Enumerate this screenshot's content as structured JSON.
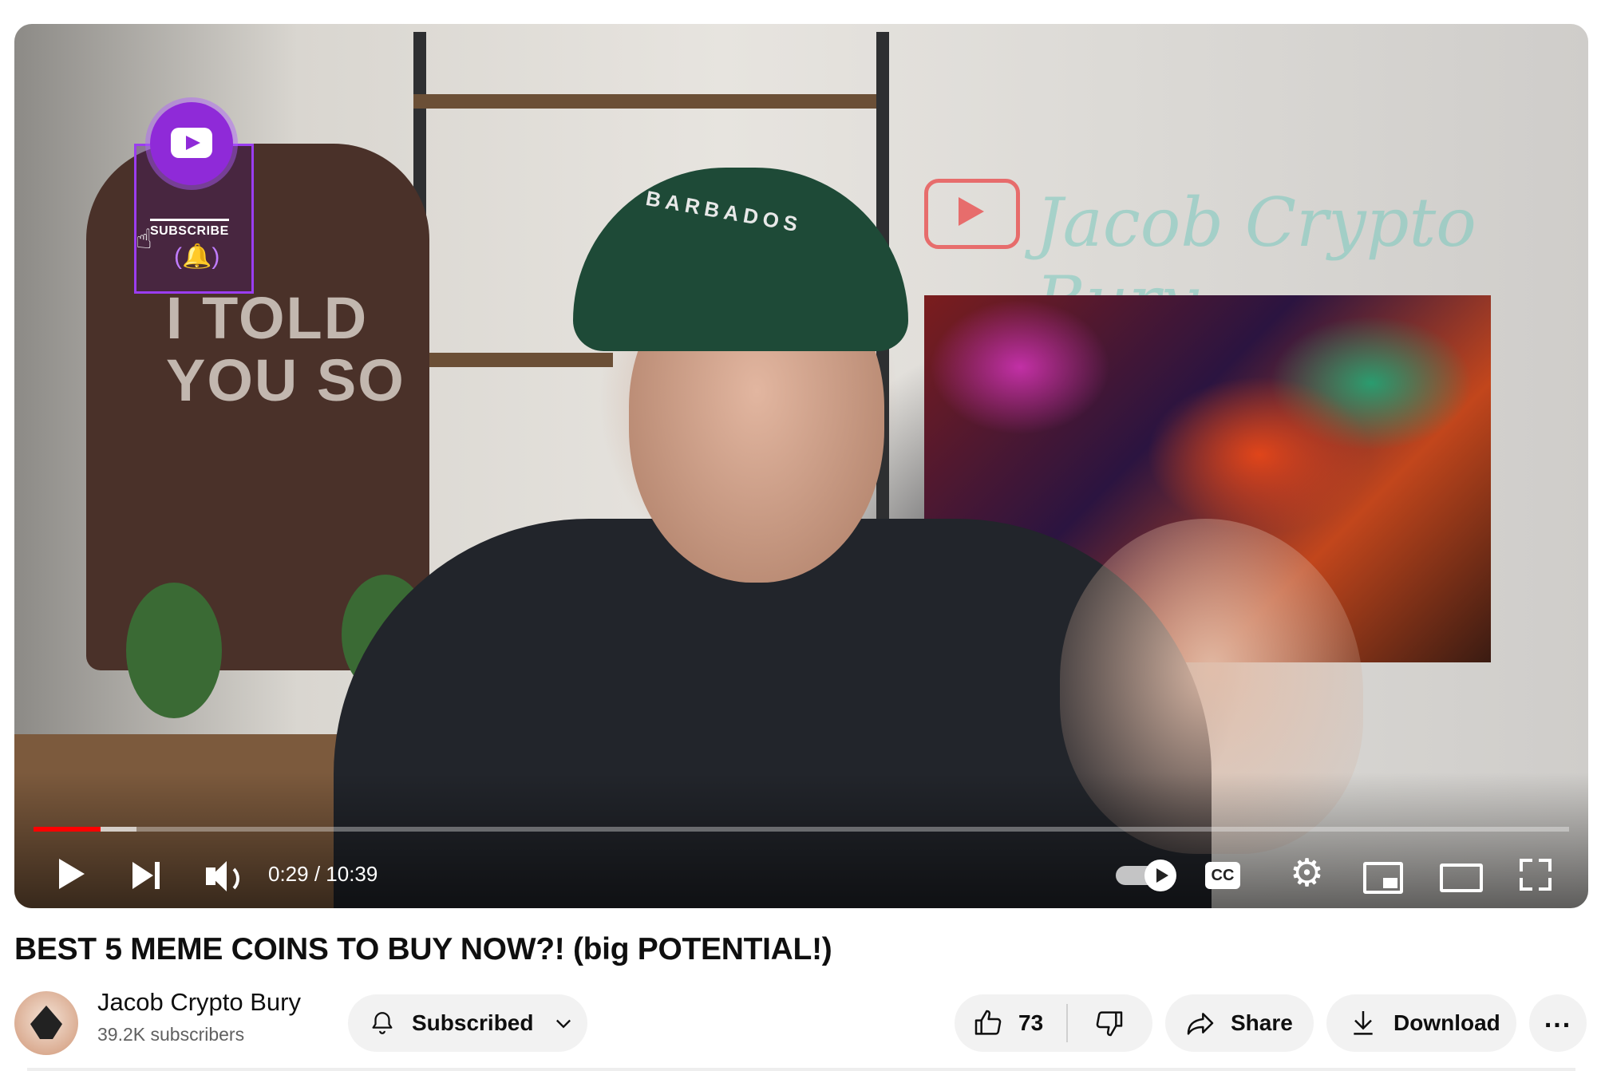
{
  "player": {
    "overlay": {
      "subscribe_label": "SUBSCRIBE",
      "tshirt_text": "I TOLD\nYOU SO",
      "cap_text": "BARBADOS",
      "neon_text": "Jacob Crypto Bury"
    },
    "progress": {
      "played_fraction": 0.0436,
      "buffered_fraction": 0.067
    },
    "time_display": "0:29 / 10:39",
    "controls": {
      "play": "play-icon",
      "next": "next-icon",
      "volume": "volume-icon",
      "autoplay": "autoplay-toggle",
      "captions_label": "CC",
      "settings": "gear-icon",
      "miniplayer": "miniplayer-icon",
      "theater": "theater-icon",
      "fullscreen": "fullscreen-icon"
    },
    "colors": {
      "progress_played": "#ff0000",
      "subscribe_accent": "#8f2ad8"
    }
  },
  "video": {
    "title": "BEST 5 MEME COINS TO BUY NOW?! (big POTENTIAL!)"
  },
  "channel": {
    "name": "Jacob Crypto Bury",
    "subscribers": "39.2K subscribers"
  },
  "actions": {
    "subscribed_label": "Subscribed",
    "like_count": "73",
    "share_label": "Share",
    "download_label": "Download",
    "more_label": "..."
  }
}
